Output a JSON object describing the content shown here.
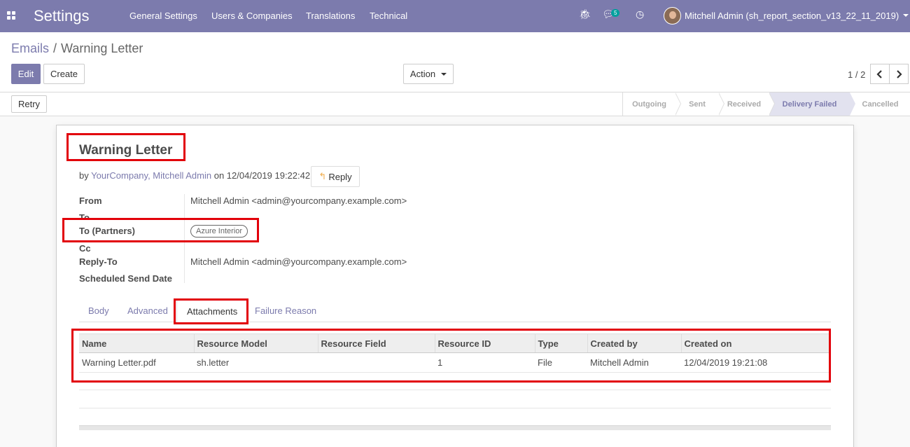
{
  "navbar": {
    "app_title": "Settings",
    "menu": [
      "General Settings",
      "Users & Companies",
      "Translations",
      "Technical"
    ],
    "debug_icon": "bug-icon",
    "messages_icon": "comments-icon",
    "messages_count": "5",
    "activity_icon": "clock-icon",
    "user": "Mitchell Admin (sh_report_section_v13_22_11_2019)"
  },
  "breadcrumb": {
    "parent": "Emails",
    "separator": "/",
    "current": "Warning Letter"
  },
  "buttons": {
    "edit": "Edit",
    "create": "Create",
    "action": "Action",
    "retry": "Retry",
    "reply": "Reply"
  },
  "pager": {
    "value": "1 / 2"
  },
  "statusbar": {
    "stages": [
      "Outgoing",
      "Sent",
      "Received",
      "Delivery Failed",
      "Cancelled"
    ],
    "active": "Delivery Failed"
  },
  "record": {
    "title": "Warning Letter",
    "by_prefix": "by",
    "authors": "YourCompany, Mitchell Admin",
    "on_text": "on 12/04/2019 19:22:42",
    "fields": {
      "from_label": "From",
      "from_value": "Mitchell Admin <admin@yourcompany.example.com>",
      "to_label": "To",
      "to_partners_label": "To (Partners)",
      "to_partners_tag": "Azure Interior",
      "cc_label": "Cc",
      "reply_to_label": "Reply-To",
      "reply_to_value": "Mitchell Admin <admin@yourcompany.example.com>",
      "scheduled_label": "Scheduled Send Date"
    }
  },
  "tabs": [
    "Body",
    "Advanced",
    "Attachments",
    "Failure Reason"
  ],
  "active_tab": "Attachments",
  "attachments": {
    "columns": [
      "Name",
      "Resource Model",
      "Resource Field",
      "Resource ID",
      "Type",
      "Created by",
      "Created on"
    ],
    "rows": [
      [
        "Warning Letter.pdf",
        "sh.letter",
        "",
        "1",
        "File",
        "Mitchell Admin",
        "12/04/2019 19:21:08"
      ]
    ]
  },
  "colors": {
    "brand": "#7c7bad",
    "highlight": "#e2000a",
    "badge": "#00a09d"
  }
}
